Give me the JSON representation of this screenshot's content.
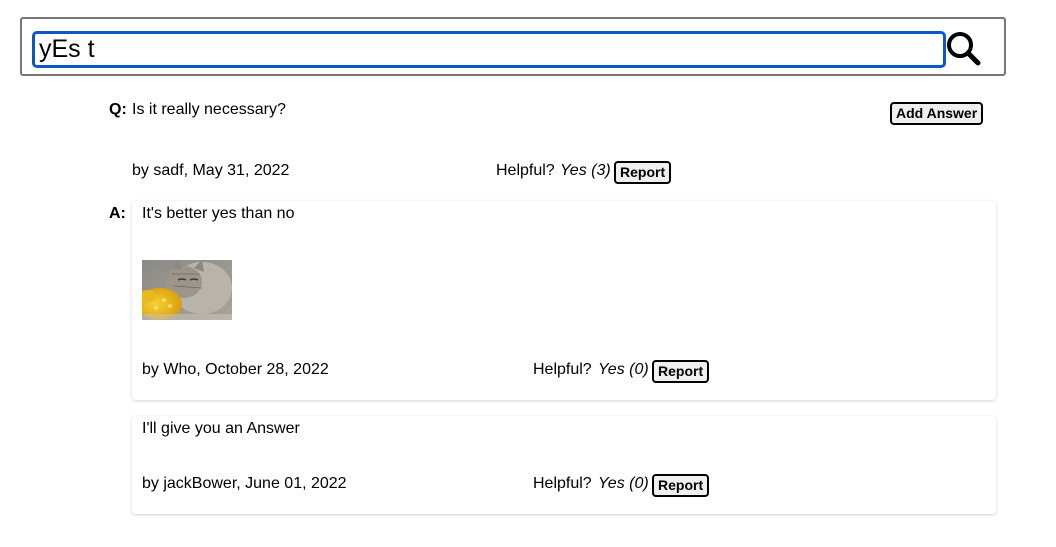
{
  "search": {
    "value": "yEs t",
    "icon": "magnifier-icon"
  },
  "question": {
    "prefix": "Q:",
    "body": "Is it really necessary?",
    "add_answer_label": "Add Answer",
    "byline": "by sadf, May 31, 2022",
    "helpful_label": "Helpful?",
    "helpful_value": "Yes (3)",
    "report_label": "Report"
  },
  "answers_prefix": "A:",
  "answers": [
    {
      "body": "It's better yes than no",
      "photo": "cat-eating-corn-photo",
      "byline": "by Who, October 28, 2022",
      "helpful_label": "Helpful?",
      "helpful_value": "Yes (0)",
      "report_label": "Report"
    },
    {
      "body": "I'll give you an Answer",
      "byline": "by jackBower, June 01, 2022",
      "helpful_label": "Helpful?",
      "helpful_value": "Yes (0)",
      "report_label": "Report"
    }
  ],
  "colors": {
    "focus_ring": "#0b57c8",
    "border": "#767676",
    "button_bg": "#efefef"
  }
}
